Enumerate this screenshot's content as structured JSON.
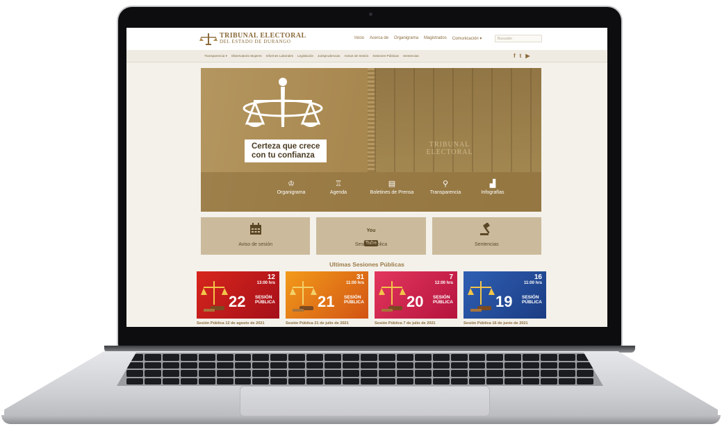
{
  "site": {
    "logo": {
      "line1": "TRIBUNAL ELECTORAL",
      "line2": "DEL ESTADO DE DURANGO"
    },
    "topnav": [
      "Inicio",
      "Acerca de",
      "Organigrama",
      "Magistrados",
      "Comunicación ▾"
    ],
    "search_placeholder": "Buscador",
    "subnav": [
      "Transparencia ▾",
      "Observatorio Mujeres",
      "Informes Laborales",
      "Legislación",
      "Jurisprudencias",
      "Avisos de Sesión",
      "Sesiones Públicas",
      "Sentencias"
    ],
    "social": {
      "facebook": "f",
      "twitter": "t",
      "youtube": "▶"
    },
    "hero": {
      "slogan_line1": "Certeza que crece",
      "slogan_line2": "con tu confianza",
      "building_label_1": "TRIBUNAL",
      "building_label_2": "ELECTORAL",
      "links": [
        {
          "icon": "org-chart-icon",
          "glyph": "♔",
          "label": "Organigrama"
        },
        {
          "icon": "agenda-icon",
          "glyph": "♖",
          "label": "Agenda"
        },
        {
          "icon": "newspaper-icon",
          "glyph": "▤",
          "label": "Boletines de Prensa"
        },
        {
          "icon": "search-icon",
          "glyph": "⚲",
          "label": "Transparencia"
        },
        {
          "icon": "chart-icon",
          "glyph": "▟",
          "label": "Infografías"
        }
      ]
    },
    "tiles": [
      {
        "icon": "calendar-icon",
        "label": "Aviso de sesión"
      },
      {
        "icon": "youtube-icon",
        "yt_top": "You",
        "yt_box": "Tube",
        "label": "Sesión Pública"
      },
      {
        "icon": "gavel-icon",
        "label": "Sentencias"
      }
    ],
    "section_title": "Ultimas Sesiones Públicas",
    "sessions": [
      {
        "day": "12",
        "time": "13:00 hrs",
        "number": "22",
        "word1": "SESIÓN",
        "word2": "PÚBLICA",
        "caption": "Sesión Pública 12 de agosto de 2021"
      },
      {
        "day": "31",
        "time": "11:00 hrs",
        "number": "21",
        "word1": "SESIÓN",
        "word2": "PÚBLICA",
        "caption": "Sesión Pública 21 de julio de 2021"
      },
      {
        "day": "7",
        "time": "12:00 hrs",
        "number": "20",
        "word1": "SESIÓN",
        "word2": "PÚBLICA",
        "caption": "Sesión Pública 7 de julio de 2021"
      },
      {
        "day": "16",
        "time": "11:00 hrs",
        "number": "19",
        "word1": "SESIÓN",
        "word2": "PÚBLICA",
        "caption": "Sesión Pública 16 de junio de 2021"
      }
    ]
  },
  "colors": {
    "brand_gold": "#8a6a3a",
    "hero_bg": "#a8884f",
    "tile_bg": "#cbbb9c"
  }
}
